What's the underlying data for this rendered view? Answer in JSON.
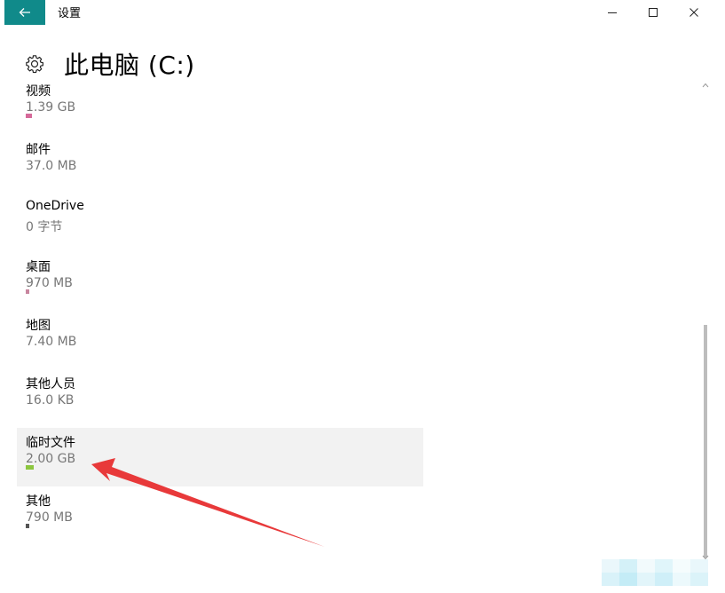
{
  "window": {
    "title": "设置"
  },
  "header": {
    "title": "此电脑 (C:)"
  },
  "items": [
    {
      "name": "视频",
      "size": "1.39 GB",
      "bar_color": "#d66a9a",
      "bar_fraction": 0.015,
      "highlighted": false
    },
    {
      "name": "邮件",
      "size": "37.0 MB",
      "bar_color": "#d66a9a",
      "bar_fraction": 0.0,
      "highlighted": false
    },
    {
      "name": "OneDrive",
      "size": "0 字节",
      "bar_color": "#888888",
      "bar_fraction": 0.0,
      "highlighted": false
    },
    {
      "name": "桌面",
      "size": "970 MB",
      "bar_color": "#c8859e",
      "bar_fraction": 0.008,
      "highlighted": false
    },
    {
      "name": "地图",
      "size": "7.40 MB",
      "bar_color": "#888888",
      "bar_fraction": 0.0,
      "highlighted": false
    },
    {
      "name": "其他人员",
      "size": "16.0 KB",
      "bar_color": "#888888",
      "bar_fraction": 0.0,
      "highlighted": false
    },
    {
      "name": "临时文件",
      "size": "2.00 GB",
      "bar_color": "#8cc63f",
      "bar_fraction": 0.02,
      "highlighted": true
    },
    {
      "name": "其他",
      "size": "790 MB",
      "bar_color": "#555555",
      "bar_fraction": 0.008,
      "highlighted": false
    }
  ],
  "colors": {
    "accent": "#108a8a",
    "annotation_arrow": "#e8393a"
  },
  "icons": {
    "back": "back-arrow-icon",
    "settings": "gear-icon",
    "minimize": "minimize-icon",
    "maximize": "maximize-icon",
    "close": "close-icon"
  }
}
